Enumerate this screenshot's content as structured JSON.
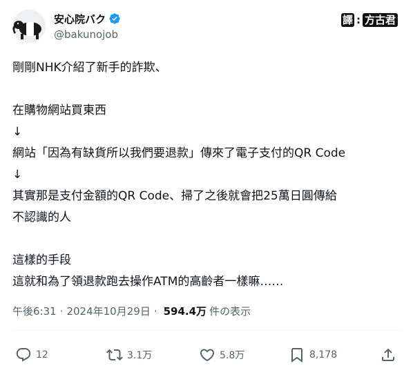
{
  "author": {
    "display_name": "安心院バク",
    "handle": "@bakunojob",
    "avatar_icon": "tapir-avatar-icon",
    "verified_icon": "verified-badge-icon",
    "verified_color": "#1d9bf0"
  },
  "translator": {
    "label": "譯",
    "separator": ":",
    "name": "方古君"
  },
  "tweet": {
    "lines": [
      "剛剛NHK介紹了新手的詐欺、",
      "",
      "在購物網站買東西",
      "↓",
      "網站「因為有缺貨所以我們要退款」傳來了電子支付的QR Code",
      "↓",
      "其實那是支付金額的QR Code、掃了之後就會把25萬日圓傳給",
      "不認識的人",
      "",
      "這樣的手段",
      "這就和為了領退款跑去操作ATM的高齡者一樣嘛……"
    ]
  },
  "meta": {
    "time": "午後6:31",
    "separator": "·",
    "date": "2024年10月29日",
    "views_count": "594.4万",
    "views_label": "件の表示"
  },
  "actions": {
    "reply_count": "12",
    "retweet_count": "3.1万",
    "like_count": "5.8万",
    "bookmark_count": "8,178",
    "icons": [
      "reply-icon",
      "retweet-icon",
      "like-icon",
      "bookmark-icon",
      "share-icon"
    ],
    "icon_color": "#536471"
  }
}
